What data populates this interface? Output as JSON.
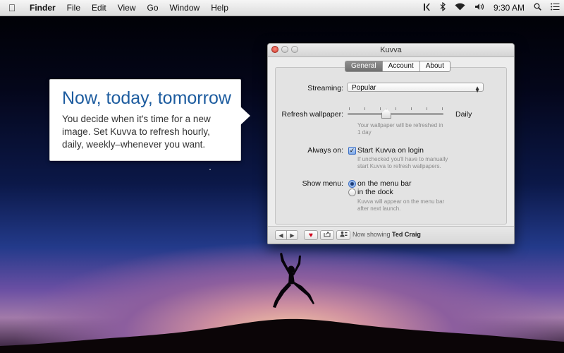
{
  "menubar": {
    "app": "Finder",
    "menus": [
      "File",
      "Edit",
      "View",
      "Go",
      "Window",
      "Help"
    ],
    "time": "9:30 AM"
  },
  "callout": {
    "title": "Now, today, tomorrow",
    "body": "You decide when it's time for a new image. Set Kuvva to refresh hourly, daily, weekly–whenever you want."
  },
  "window": {
    "title": "Kuvva",
    "tabs": [
      {
        "label": "General",
        "active": true
      },
      {
        "label": "Account",
        "active": false
      },
      {
        "label": "About",
        "active": false
      }
    ],
    "streaming": {
      "label": "Streaming:",
      "value": "Popular"
    },
    "refresh": {
      "label": "Refresh wallpaper:",
      "value_label": "Daily",
      "note": "Your wallpaper will be refreshed in 1 day",
      "level": 0.4
    },
    "always_on": {
      "label": "Always on:",
      "checkbox_label": "Start Kuvva on login",
      "checked": true,
      "note": "If unchecked you'll have to manually start Kuvva to refresh wallpapers."
    },
    "show_menu": {
      "label": "Show menu:",
      "options": [
        "on the menu bar",
        "in the dock"
      ],
      "selected": "on the menu bar",
      "note": "Kuvva will appear on the menu bar after next launch."
    },
    "bottom": {
      "now_showing_prefix": "Now showing",
      "author": "Ted Craig"
    }
  },
  "colors": {
    "callout_title": "#1d5c9f",
    "heart": "#d0021b",
    "checkbox": "#3b6ec4"
  }
}
